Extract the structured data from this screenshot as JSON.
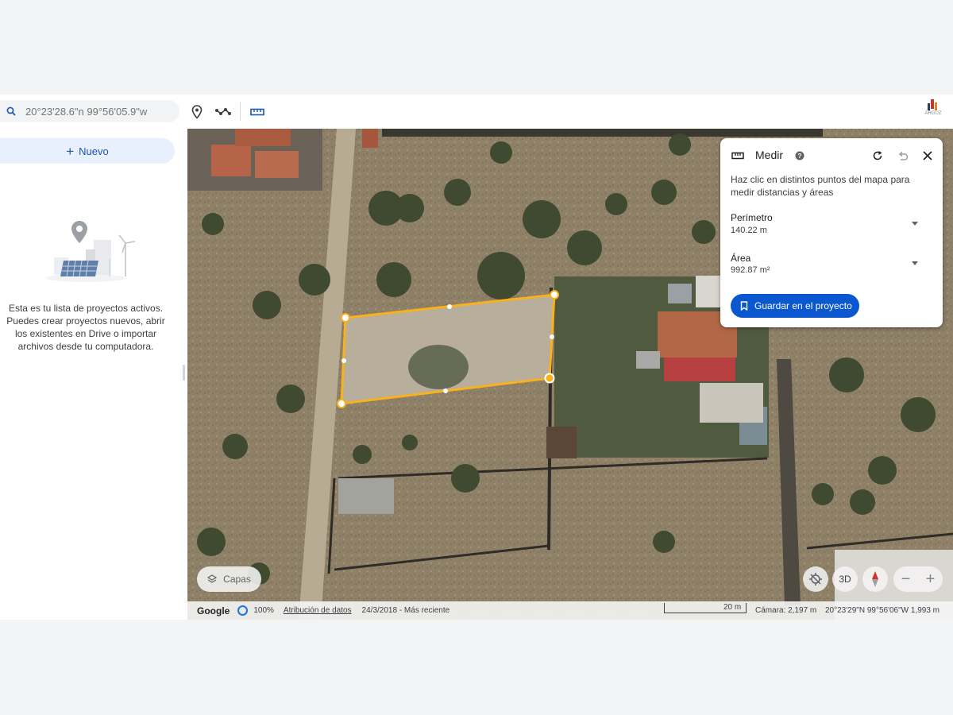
{
  "search": {
    "placeholder": "20°23'28.6\"n 99°56'05.9\"w"
  },
  "toolbar": {
    "tools": [
      "add-placemark",
      "draw-line-or-shape",
      "measure"
    ]
  },
  "sidebar": {
    "new_label": "Nuevo",
    "empty_text": "Esta es tu lista de proyectos activos. Puedes crear proyectos nuevos, abrir los existentes en Drive o importar archivos desde tu computadora."
  },
  "measure_panel": {
    "title": "Medir",
    "description": "Haz clic en distintos puntos del mapa para medir distancias y áreas",
    "perimeter_label": "Perímetro",
    "perimeter_value": "140.22 m",
    "area_label": "Área",
    "area_value": "992.87 m²",
    "save_label": "Guardar en el proyecto"
  },
  "map_controls": {
    "layers_label": "Capas",
    "view_3d_label": "3D",
    "zoom_out": "−",
    "zoom_in": "+"
  },
  "statusbar": {
    "brand": "Google",
    "load_percent": "100%",
    "attribution": "Atribución de datos",
    "imagery_date": "24/3/2018 - Más reciente",
    "scale_label": "20 m",
    "camera": "Cámara: 2,197 m",
    "coordinates": "20°23'29\"N 99°56'06\"W  1,993 m"
  },
  "colors": {
    "accent": "#0b57d0",
    "measure_line": "#f9b11c",
    "new_button_bg": "#e8f0fe"
  }
}
